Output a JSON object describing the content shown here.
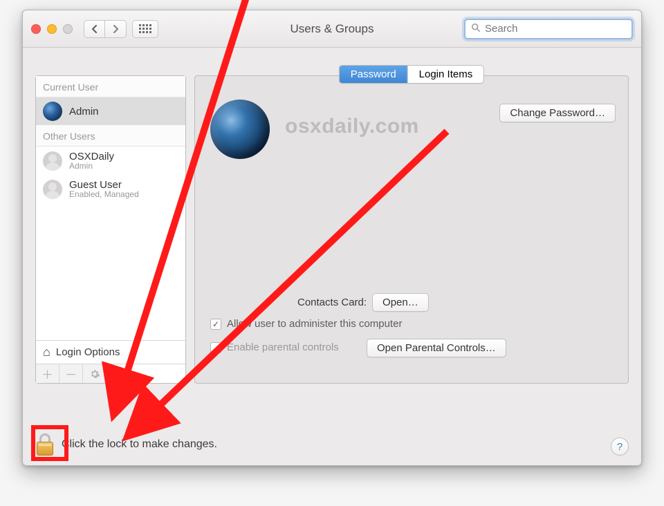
{
  "window": {
    "title": "Users & Groups"
  },
  "search": {
    "placeholder": "Search"
  },
  "sidebar": {
    "current_header": "Current User",
    "others_header": "Other Users",
    "current": {
      "name": "Admin"
    },
    "items": [
      {
        "name": "OSXDaily",
        "sub": "Admin"
      },
      {
        "name": "Guest User",
        "sub": "Enabled, Managed"
      }
    ],
    "login_options": "Login Options"
  },
  "tabs": {
    "password": "Password",
    "login_items": "Login Items"
  },
  "watermark": "osxdaily.com",
  "buttons": {
    "change_password": "Change Password…",
    "open": "Open…",
    "open_parental": "Open Parental Controls…"
  },
  "labels": {
    "contacts_card": "Contacts Card:",
    "allow_admin": "Allow user to administer this computer",
    "enable_parental": "Enable parental controls"
  },
  "lock": {
    "text": "Click the lock to make changes."
  }
}
